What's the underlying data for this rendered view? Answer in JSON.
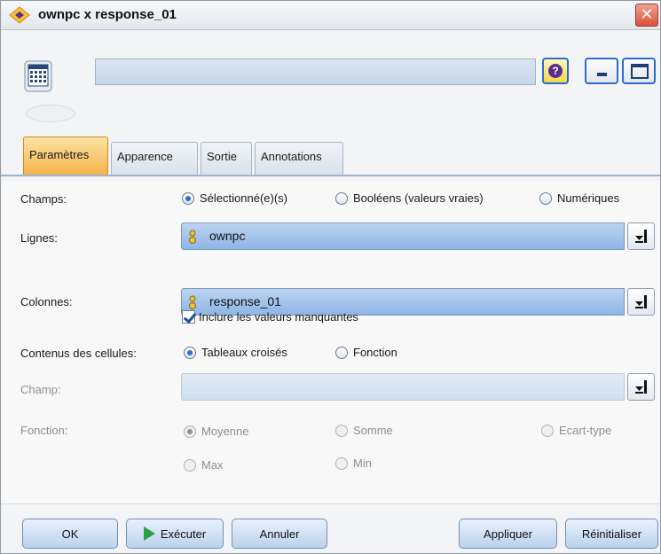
{
  "window": {
    "title": "ownpc x response_01",
    "close_symbol": "✕"
  },
  "header": {
    "node_name": "",
    "help_symbol": "?"
  },
  "tabs": [
    {
      "label": "Paramètres",
      "active": true
    },
    {
      "label": "Apparence",
      "active": false
    },
    {
      "label": "Sortie",
      "active": false
    },
    {
      "label": "Annotations",
      "active": false
    }
  ],
  "form": {
    "champs": {
      "label": "Champs:",
      "options": [
        "Sélectionné(e)(s)",
        "Booléens (valeurs vraies)",
        "Numériques"
      ],
      "selected": "Sélectionné(e)(s)"
    },
    "lignes": {
      "label": "Lignes:",
      "value": "ownpc"
    },
    "colonnes": {
      "label": "Colonnes:",
      "value": "response_01"
    },
    "inclure": {
      "label": "Inclure les valeurs manquantes",
      "checked": true
    },
    "contenus": {
      "label": "Contenus des cellules:",
      "options": [
        "Tableaux croisés",
        "Fonction"
      ],
      "selected": "Tableaux croisés"
    },
    "champ": {
      "label": "Champ:",
      "value": ""
    },
    "fonction": {
      "label": "Fonction:",
      "options": [
        "Moyenne",
        "Somme",
        "Ecart-type",
        "Max",
        "Min"
      ],
      "selected": "Moyenne"
    }
  },
  "footer": {
    "ok": "OK",
    "executer": "Exécuter",
    "annuler": "Annuler",
    "appliquer": "Appliquer",
    "reinitialiser": "Réinitialiser"
  },
  "colors": {
    "accent": "#2b6ccf",
    "active_tab": "#f5b24a",
    "field_blue": "#8db5e6",
    "run_green": "#27a346"
  },
  "icons": [
    "matrix-node-icon",
    "help-icon",
    "minimize-icon",
    "maximize-icon",
    "close-icon",
    "field-type-icon",
    "field-picker-icon",
    "play-icon"
  ]
}
